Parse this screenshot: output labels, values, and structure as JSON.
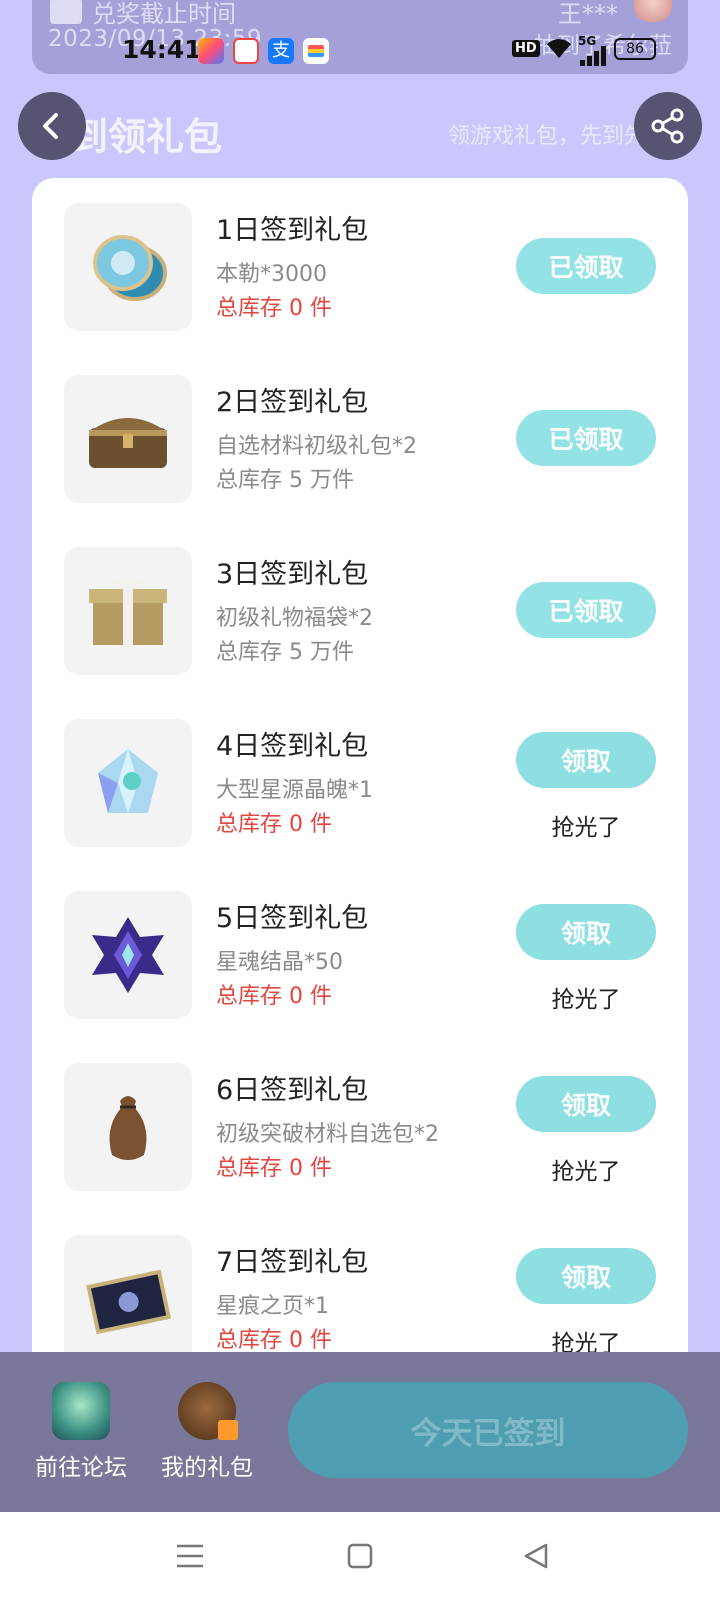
{
  "notice": {
    "title": "兑奖截止时间",
    "date": "2023/09/13 23:59",
    "user": "王***",
    "status": "抽到了希尔菈"
  },
  "statusbar": {
    "time": "14:41",
    "hd": "HD",
    "network": "5G",
    "battery": "86",
    "alipay_glyph": "支"
  },
  "header": {
    "title": "签到领礼包",
    "subtitle": "领游戏礼包，先到先得",
    "back_icon": "chevron-left-icon",
    "share_icon": "share-icon"
  },
  "gifts": [
    {
      "name": "1日签到礼包",
      "desc": "本勒*3000",
      "stock": "总库存 0 件",
      "stock_color": "red",
      "button": "已领取",
      "state": "claimed",
      "icon": "coins-icon"
    },
    {
      "name": "2日签到礼包",
      "desc": "自选材料初级礼包*2",
      "stock": "总库存 5 万件",
      "stock_color": "gray",
      "button": "已领取",
      "state": "claimed",
      "icon": "treasure-chest-icon"
    },
    {
      "name": "3日签到礼包",
      "desc": "初级礼物福袋*2",
      "stock": "总库存 5 万件",
      "stock_color": "gray",
      "button": "已领取",
      "state": "claimed",
      "icon": "gift-box-icon"
    },
    {
      "name": "4日签到礼包",
      "desc": "大型星源晶魄*1",
      "stock": "总库存 0 件",
      "stock_color": "red",
      "button": "领取",
      "state": "soldout",
      "soldout": "抢光了",
      "icon": "crystal-icon"
    },
    {
      "name": "5日签到礼包",
      "desc": "星魂结晶*50",
      "stock": "总库存 0 件",
      "stock_color": "red",
      "button": "领取",
      "state": "soldout",
      "soldout": "抢光了",
      "icon": "star-crystal-icon"
    },
    {
      "name": "6日签到礼包",
      "desc": "初级突破材料自选包*2",
      "stock": "总库存 0 件",
      "stock_color": "red",
      "button": "领取",
      "state": "soldout",
      "soldout": "抢光了",
      "icon": "pouch-icon"
    },
    {
      "name": "7日签到礼包",
      "desc": "星痕之页*1",
      "stock": "总库存 0 件",
      "stock_color": "red",
      "button": "领取",
      "state": "soldout",
      "soldout": "抢光了",
      "icon": "page-card-icon"
    }
  ],
  "bottom": {
    "forum_label": "前往论坛",
    "mygifts_label": "我的礼包",
    "signed_label": "今天已签到"
  },
  "colors": {
    "background": "#c9c7fb",
    "claim_button": "#93e3e6",
    "stock_zero": "#e5453f",
    "signed_button": "#4f9db0"
  }
}
